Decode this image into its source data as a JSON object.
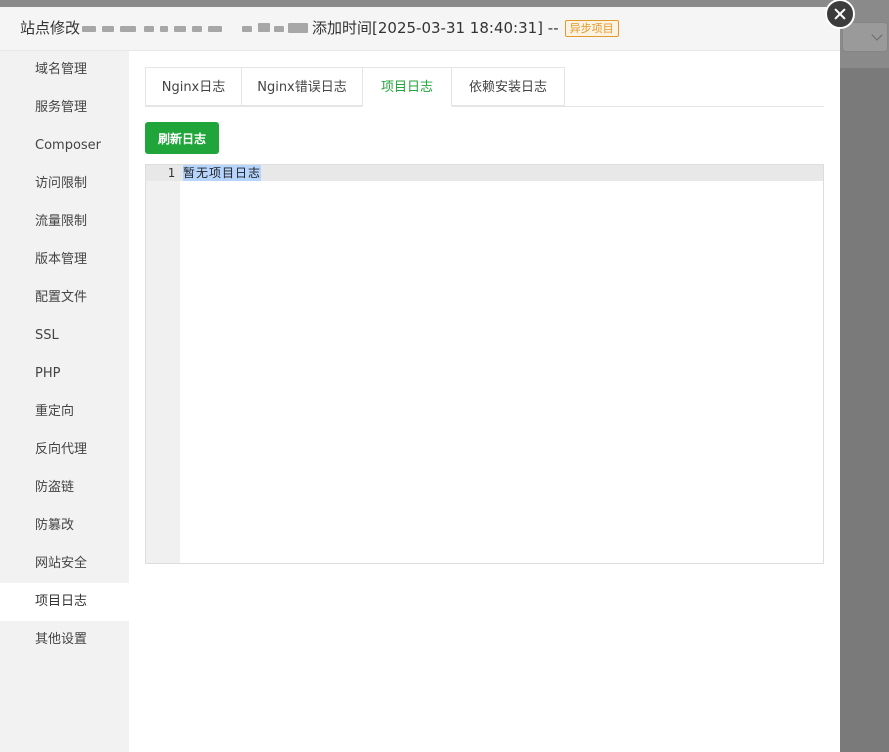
{
  "dialog": {
    "title_prefix": "站点修改",
    "title_suffix": "添加时间[2025-03-31 18:40:31] --",
    "badge": "异步项目",
    "close_icon": "close-icon"
  },
  "sidebar": {
    "items": [
      {
        "label": "域名管理"
      },
      {
        "label": "服务管理"
      },
      {
        "label": "Composer"
      },
      {
        "label": "访问限制"
      },
      {
        "label": "流量限制"
      },
      {
        "label": "版本管理"
      },
      {
        "label": "配置文件"
      },
      {
        "label": "SSL"
      },
      {
        "label": "PHP"
      },
      {
        "label": "重定向"
      },
      {
        "label": "反向代理"
      },
      {
        "label": "防盗链"
      },
      {
        "label": "防篡改"
      },
      {
        "label": "网站安全"
      },
      {
        "label": "项目日志"
      },
      {
        "label": "其他设置"
      }
    ],
    "active": "项目日志"
  },
  "tabs": [
    {
      "label": "Nginx日志"
    },
    {
      "label": "Nginx错误日志"
    },
    {
      "label": "项目日志"
    },
    {
      "label": "依赖安装日志"
    }
  ],
  "active_tab": "项目日志",
  "refresh_button": "刷新日志",
  "editor": {
    "line_number": "1",
    "text": "暂无项目日志"
  },
  "colors": {
    "accent": "#20a53a",
    "badge": "#e29a2d"
  }
}
